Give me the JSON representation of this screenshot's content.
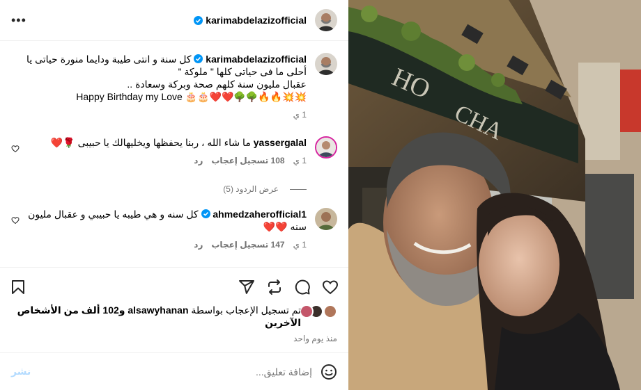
{
  "header": {
    "username": "karimabdelazizofficial",
    "more_label": "•••"
  },
  "caption": {
    "username": "karimabdelazizofficial",
    "line1": "كل سنة و انتى طيبة ودايما منورة حياتى يا",
    "line2": "أحلى ما فى حياتى كلها \" ملوكة \"",
    "line3": "عقبال مليون سنة كلهم صحة وبركة وسعادة ..",
    "line4": "Happy Birthday my Love 🎂🎂❤️❤️🌳🌳🔥🔥💥💥",
    "age": "1 ي"
  },
  "comments": [
    {
      "username": "yassergalal",
      "text": "ما شاء الله ، ربنا يحفظها ويخليهالك يا حبيبى 🌹❤️",
      "age": "1 ي",
      "likes": "108 تسجيل إعجاب",
      "reply": "رد"
    },
    {
      "username": "ahmedzaherofficial1",
      "text": "كل سنه و هي طيبه يا حبيبي و عقبال مليون سنه ❤️❤️",
      "age": "1 ي",
      "likes": "147 تسجيل إعجاب",
      "reply": "رد"
    }
  ],
  "view_replies": "عرض الردود (5)",
  "likes": {
    "prefix": "تم تسجيل الإعجاب بواسطة ",
    "user": "alsawyhanan",
    "suffix": " و102 ألف من الأشخاص الآخرين"
  },
  "date": "منذ يوم واحد",
  "add_comment": {
    "placeholder": "إضافة تعليق...",
    "post_label": "نشر"
  },
  "colors": {
    "verified": "#0095f6",
    "secondary_text": "#737373",
    "post_disabled": "#b3dbff",
    "heart_red": "#ed4956"
  },
  "icons": [
    "more-icon",
    "verified-icon",
    "heart-icon",
    "comment-icon",
    "share-icon",
    "repost-icon",
    "save-icon",
    "emoji-icon"
  ]
}
